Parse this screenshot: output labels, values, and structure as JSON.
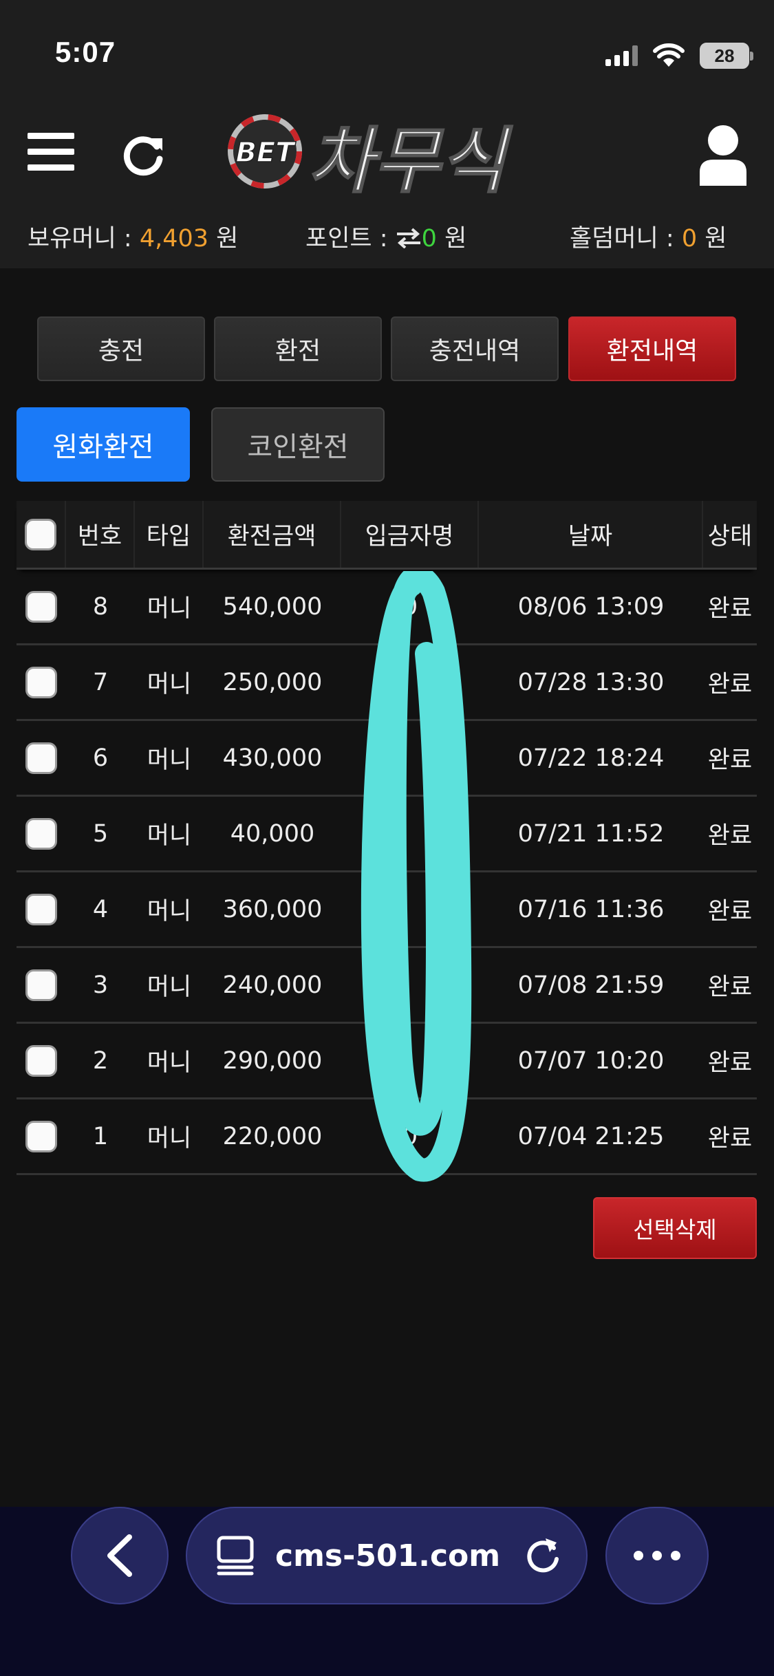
{
  "status_bar": {
    "time": "5:07",
    "battery": "28"
  },
  "header": {
    "logo_text": "BET 차무식",
    "balance_label": "보유머니 : ",
    "balance_value": "4,403",
    "balance_unit": " 원",
    "point_label": "포인트 : ",
    "point_value": "0",
    "point_unit": " 원",
    "holdem_label": "홀덤머니 : ",
    "holdem_value": "0",
    "holdem_unit": " 원"
  },
  "tabs": [
    "충전",
    "환전",
    "충전내역",
    "환전내역"
  ],
  "sub_tabs": [
    "원화환전",
    "코인환전"
  ],
  "table": {
    "headers": [
      "번호",
      "타입",
      "환전금액",
      "입금자명",
      "날짜",
      "상태"
    ],
    "rows": [
      {
        "no": "8",
        "type": "머니",
        "amount": "540,000",
        "name": "0",
        "date": "08/06 13:09",
        "status": "완료"
      },
      {
        "no": "7",
        "type": "머니",
        "amount": "250,000",
        "name": "",
        "date": "07/28 13:30",
        "status": "완료"
      },
      {
        "no": "6",
        "type": "머니",
        "amount": "430,000",
        "name": "",
        "date": "07/22 18:24",
        "status": "완료"
      },
      {
        "no": "5",
        "type": "머니",
        "amount": "40,000",
        "name": "",
        "date": "07/21 11:52",
        "status": "완료"
      },
      {
        "no": "4",
        "type": "머니",
        "amount": "360,000",
        "name": "",
        "date": "07/16 11:36",
        "status": "완료"
      },
      {
        "no": "3",
        "type": "머니",
        "amount": "240,000",
        "name": "",
        "date": "07/08 21:59",
        "status": "완료"
      },
      {
        "no": "2",
        "type": "머니",
        "amount": "290,000",
        "name": "",
        "date": "07/07 10:20",
        "status": "완료"
      },
      {
        "no": "1",
        "type": "머니",
        "amount": "220,000",
        "name": "0",
        "date": "07/04 21:25",
        "status": "완료"
      }
    ]
  },
  "delete_button": "선택삭제",
  "browser": {
    "url": "cms-501.com"
  },
  "icons": {
    "menu": "hamburger-menu-icon",
    "refresh": "refresh-icon",
    "user": "user-icon",
    "transfer": "transfer-arrows-icon",
    "back": "chevron-left-icon",
    "tabs": "tabs-icon",
    "reload": "reload-icon",
    "more": "more-icon"
  },
  "colors": {
    "accent_red": "#b81c20",
    "accent_blue": "#1a7af8",
    "value_orange": "#f0a030",
    "value_green": "#3ed43e",
    "scribble": "#5ce1dc"
  }
}
